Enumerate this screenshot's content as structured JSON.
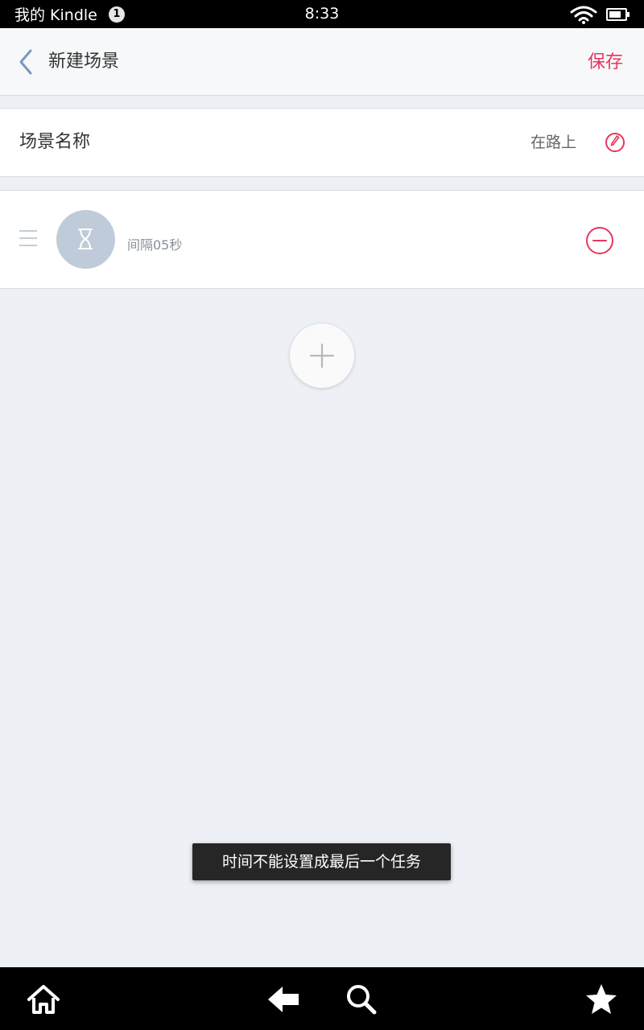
{
  "status_bar": {
    "device_name": "我的 Kindle",
    "notification_count": "1",
    "time": "8:33"
  },
  "header": {
    "title": "新建场景",
    "save_label": "保存"
  },
  "scene_name": {
    "label": "场景名称",
    "value": "在路上"
  },
  "tasks": [
    {
      "icon": "hourglass-icon",
      "label": "间隔05秒"
    }
  ],
  "toast": {
    "message": "时间不能设置成最后一个任务"
  },
  "nav_bar": {
    "items": [
      "home-icon",
      "back-arrow-icon",
      "search-icon",
      "star-icon"
    ]
  },
  "colors": {
    "accent": "#e8355e",
    "background": "#edf0f5",
    "avatar": "#bfcbd9",
    "back_icon": "#7a97bd"
  }
}
